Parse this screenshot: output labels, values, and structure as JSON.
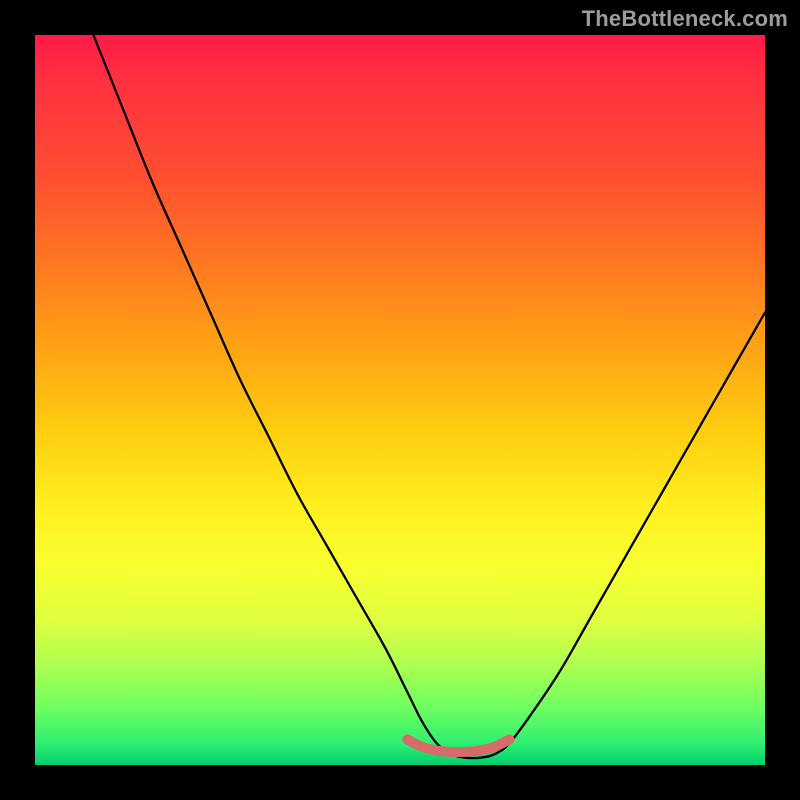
{
  "watermark_text": "TheBottleneck.com",
  "colors": {
    "frame": "#000000",
    "curve_main": "#000000",
    "curve_bottom": "#d86a6a",
    "gradient_top": "#ff1a47",
    "gradient_bottom": "#00d070"
  },
  "chart_data": {
    "type": "line",
    "title": "",
    "xlabel": "",
    "ylabel": "",
    "xlim": [
      0,
      100
    ],
    "ylim": [
      0,
      100
    ],
    "grid": false,
    "series": [
      {
        "name": "main-curve",
        "x": [
          8,
          12,
          16,
          20,
          24,
          28,
          32,
          36,
          40,
          44,
          48,
          51,
          53,
          55,
          57,
          59,
          61,
          63,
          65,
          68,
          72,
          76,
          80,
          84,
          88,
          92,
          96,
          100
        ],
        "y": [
          100,
          90,
          80,
          71,
          62,
          53,
          45,
          37,
          30,
          23,
          16,
          10,
          6,
          3,
          1.5,
          1,
          1,
          1.5,
          3,
          7,
          13,
          20,
          27,
          34,
          41,
          48,
          55,
          62
        ]
      },
      {
        "name": "bottom-highlight",
        "x": [
          51,
          53,
          55,
          57,
          59,
          61,
          63,
          65
        ],
        "y": [
          3.5,
          2.5,
          2,
          1.8,
          1.8,
          2,
          2.5,
          3.5
        ]
      }
    ]
  }
}
